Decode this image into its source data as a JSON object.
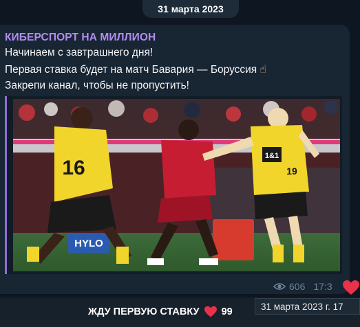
{
  "date_header": "31 марта 2023",
  "message": {
    "channel_name": "КИБЕРСПОРТ НА МИЛЛИОН",
    "lines": [
      "Начинаем с завтрашнего дня!",
      "Первая ставка будет на матч Бавария — Боруссия",
      "Закрепи канал, чтобы не пропустить!"
    ],
    "line2_emoji": "☝",
    "photo": {
      "jersey_numbers": [
        "16",
        "19"
      ],
      "board_text": "HYLO",
      "sponsor_text": "1&1"
    },
    "views": "606",
    "time": "17:3",
    "side_reaction_icon": "heart-icon"
  },
  "reaction_button": {
    "label": "ЖДУ ПЕРВУЮ СТАВКУ",
    "icon": "heart-icon",
    "count": "99"
  },
  "tooltip": "31 марта 2023 г. 17",
  "colors": {
    "background": "#0e1621",
    "bubble": "#182533",
    "channel_name": "#b28cf2",
    "accent_bar": "#8f6fd8",
    "heart": "#e8324b"
  }
}
